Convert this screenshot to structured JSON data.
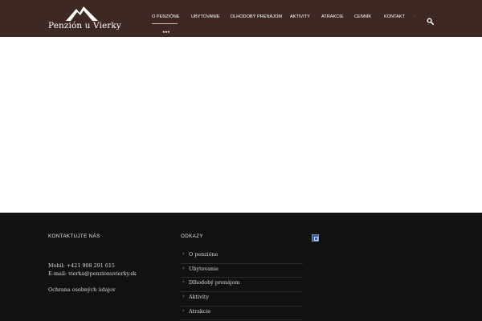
{
  "header": {
    "logo_text": "Penzión u Vierky",
    "logo_stars": "★★★",
    "nav": [
      {
        "label": "O PENZIÓNE",
        "active": true
      },
      {
        "label": "UBYTOVANIE",
        "active": false
      },
      {
        "label": "DLHODOBÝ PRENÁJOM",
        "active": false
      },
      {
        "label": "AKTIVITY",
        "active": false
      },
      {
        "label": "ATRAKCIE",
        "active": false
      },
      {
        "label": "CENNÍK",
        "active": false
      },
      {
        "label": "KONTAKT",
        "active": false
      }
    ],
    "nav_separator": "·",
    "search_icon": "search-icon"
  },
  "footer": {
    "contact": {
      "title": "KONTAKTUJTE NÁS",
      "phone_line": "Mobil: +421 908 291 615",
      "email_line": "E-mail: vierka@penzionuvierky.sk",
      "privacy": "Ochrana osobných údajov"
    },
    "links": {
      "title": "ODKAZY",
      "items": [
        "O penzióne",
        "Ubytovanie",
        "Dlhodobý prenájom",
        "Aktivity",
        "Atrakcie"
      ]
    }
  },
  "colors": {
    "header_bg": "#3e2824",
    "content_bg": "#ffffff",
    "footer_bg": "#111111",
    "text_light": "#ffffff"
  }
}
